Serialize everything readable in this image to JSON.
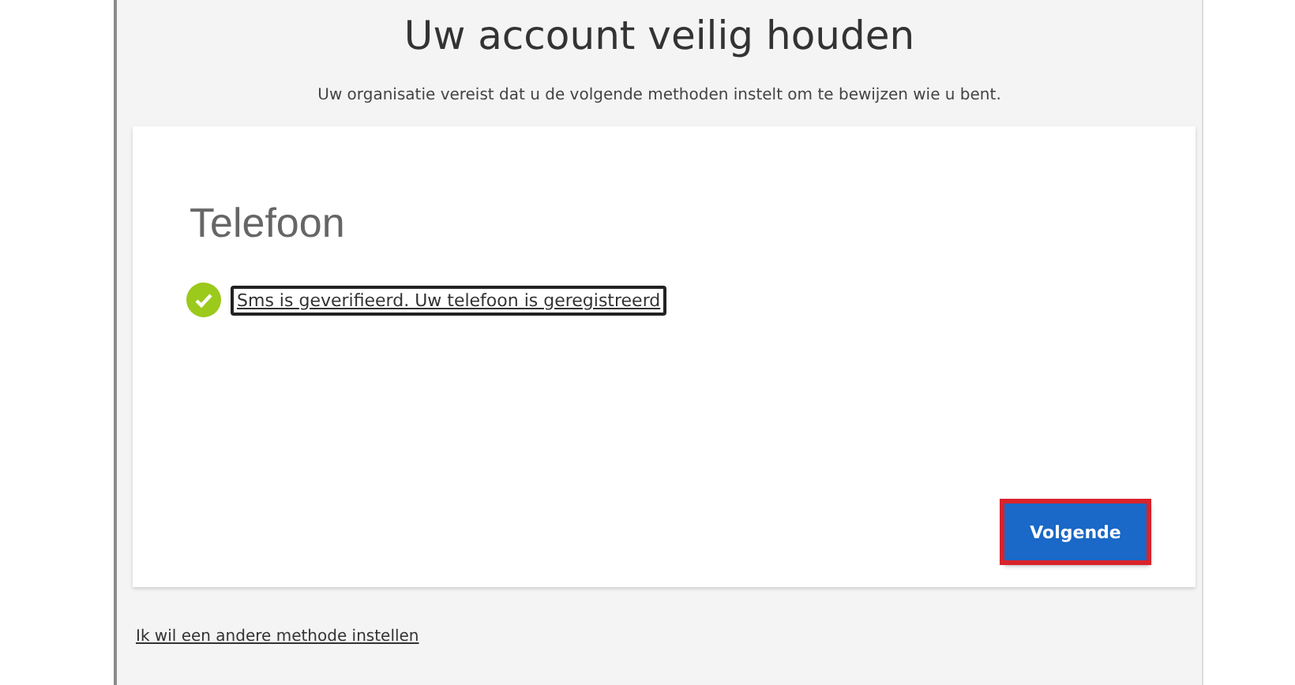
{
  "title": "Uw account veilig houden",
  "subtitle": "Uw organisatie vereist dat u de volgende methoden instelt om te bewijzen wie u bent.",
  "card": {
    "heading": "Telefoon",
    "status": {
      "text": "Sms is geverifieerd. Uw telefoon is geregistreerd",
      "verified": true,
      "focused": true
    },
    "button": {
      "label": "Volgende",
      "highlighted": true
    }
  },
  "footer_link": "Ik wil een andere methode instellen"
}
